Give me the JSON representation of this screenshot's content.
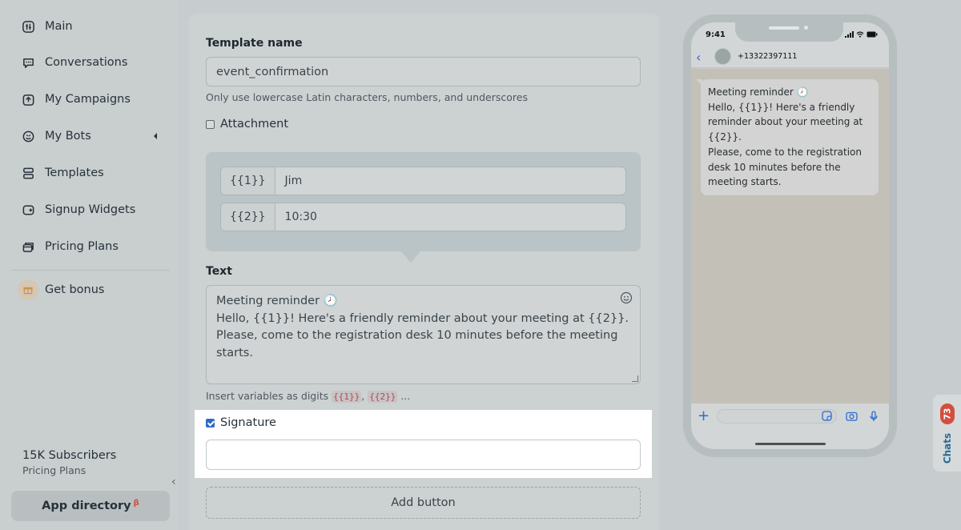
{
  "sidebar": {
    "items": [
      {
        "label": "Main",
        "icon": "main-icon"
      },
      {
        "label": "Conversations",
        "icon": "chat-bubble-icon"
      },
      {
        "label": "My Campaigns",
        "icon": "campaign-icon"
      },
      {
        "label": "My Bots",
        "icon": "bot-icon"
      },
      {
        "label": "Templates",
        "icon": "template-icon"
      },
      {
        "label": "Signup Widgets",
        "icon": "widget-icon"
      },
      {
        "label": "Pricing Plans",
        "icon": "pricing-icon"
      }
    ],
    "bonus_label": "Get bonus",
    "subscribers": "15K Subscribers",
    "plan": "Pricing Plans",
    "collapse_glyph": "‹",
    "app_directory": "App directory",
    "app_directory_badge": "β"
  },
  "form": {
    "template_name_label": "Template name",
    "template_name_value": "event_confirmation",
    "template_name_hint": "Only use lowercase Latin characters, numbers, and underscores",
    "attachment_label": "Attachment",
    "attachment_checked": false,
    "variables": [
      {
        "key": "{{1}}",
        "value": "Jim"
      },
      {
        "key": "{{2}}",
        "value": "10:30"
      }
    ],
    "text_label": "Text",
    "text_value": "Meeting reminder 🕗\nHello, {{1}}! Here's a friendly reminder about your meeting at {{2}}.\nPlease, come to the registration desk 10 minutes before the meeting\nstarts.",
    "variables_hint_prefix": "Insert variables as digits",
    "variables_hint_code1": "{{1}}",
    "variables_hint_sep": ",",
    "variables_hint_code2": "{{2}}",
    "variables_hint_suffix": "...",
    "signature_label": "Signature",
    "signature_checked": true,
    "signature_value": "",
    "add_button_label": "Add button"
  },
  "phone": {
    "time": "9:41",
    "contact_number": "+13322397111",
    "message": "Meeting reminder 🕗\nHello, {{1}}! Here's a friendly\nreminder about your meeting at\n{{2}}.\nPlease, come to the registration\ndesk 10 minutes before the\nmeeting starts."
  },
  "chats_tab": {
    "label": "Chats",
    "badge": "73"
  },
  "colors": {
    "accent": "#2a6ad4",
    "badge": "#d34e3f",
    "highlight": "#ffffff"
  }
}
